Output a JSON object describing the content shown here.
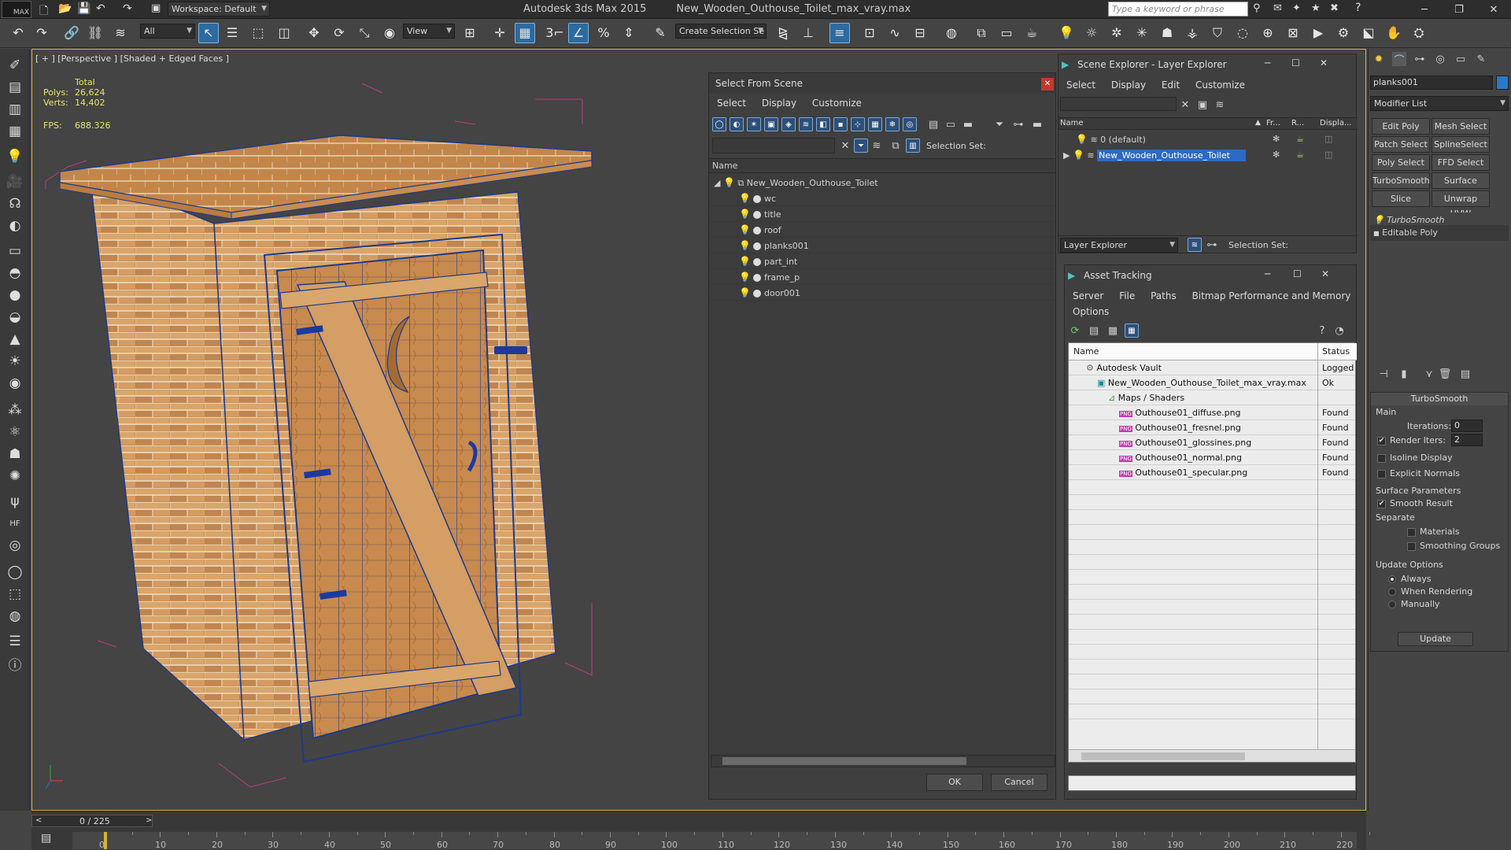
{
  "app": {
    "title": "Autodesk 3ds Max  2015",
    "file": "New_Wooden_Outhouse_Toilet_max_vray.max",
    "logo": "MAX"
  },
  "workspace": {
    "label": "Workspace: Default"
  },
  "search": {
    "placeholder": "Type a keyword or phrase"
  },
  "toolbar": {
    "filter": "All",
    "refcoord": "View",
    "selset": "Create Selection Se",
    "snap_label": "3"
  },
  "viewport": {
    "label": "[ + ] [Perspective ] [Shaded + Edged Faces ]",
    "stats": {
      "total": "Total",
      "polys_label": "Polys:",
      "polys": "26,624",
      "verts_label": "Verts:",
      "verts": "14,402",
      "fps_label": "FPS:",
      "fps": "688.326"
    }
  },
  "select_from_scene": {
    "title": "Select From Scene",
    "menu": [
      "Select",
      "Display",
      "Customize"
    ],
    "selset_label": "Selection Set:",
    "col_name": "Name",
    "root": "New_Wooden_Outhouse_Toilet",
    "children": [
      "wc",
      "title",
      "roof",
      "planks001",
      "part_int",
      "frame_p",
      "door001"
    ],
    "ok": "OK",
    "cancel": "Cancel"
  },
  "scene_explorer": {
    "title": "Scene Explorer - Layer Explorer",
    "menu": [
      "Select",
      "Display",
      "Edit",
      "Customize"
    ],
    "cols": [
      "Name",
      "Fr...",
      "R...",
      "Displa..."
    ],
    "layers": [
      "0 (default)",
      "New_Wooden_Outhouse_Toilet"
    ],
    "footer": "Layer Explorer",
    "selset_label": "Selection Set:"
  },
  "asset_tracking": {
    "title": "Asset Tracking",
    "menu": [
      "Server",
      "File",
      "Paths",
      "Bitmap Performance and Memory"
    ],
    "menu2": "Options",
    "cols": [
      "Name",
      "Status"
    ],
    "rows": [
      {
        "name": "Autodesk Vault",
        "status": "Logged",
        "indent": 0
      },
      {
        "name": "New_Wooden_Outhouse_Toilet_max_vray.max",
        "status": "Ok",
        "indent": 1
      },
      {
        "name": "Maps / Shaders",
        "status": "",
        "indent": 2
      },
      {
        "name": "Outhouse01_diffuse.png",
        "status": "Found",
        "indent": 3
      },
      {
        "name": "Outhouse01_fresnel.png",
        "status": "Found",
        "indent": 3
      },
      {
        "name": "Outhouse01_glossines.png",
        "status": "Found",
        "indent": 3
      },
      {
        "name": "Outhouse01_normal.png",
        "status": "Found",
        "indent": 3
      },
      {
        "name": "Outhouse01_specular.png",
        "status": "Found",
        "indent": 3
      }
    ],
    "png_badge": "PNG"
  },
  "command_panel": {
    "object_name": "planks001",
    "modifier_list": "Modifier List",
    "buttons": [
      "Edit Poly",
      "Mesh Select",
      "Patch Select",
      "SplineSelect",
      "Poly Select",
      "FFD Select",
      "TurboSmooth",
      "Surface Select",
      "Slice",
      "Unwrap UVW"
    ],
    "stack": [
      "TurboSmooth",
      "Editable Poly"
    ],
    "rollout": "TurboSmooth",
    "main": "Main",
    "iterations_label": "Iterations:",
    "iterations": "0",
    "render_iters_label": "Render Iters:",
    "render_iters": "2",
    "isoline": "Isoline Display",
    "explicit": "Explicit Normals",
    "surface_params": "Surface Parameters",
    "smooth_result": "Smooth Result",
    "separate": "Separate",
    "materials": "Materials",
    "smoothing_groups": "Smoothing Groups",
    "update_options": "Update Options",
    "always": "Always",
    "when_rendering": "When Rendering",
    "manually": "Manually",
    "update": "Update"
  },
  "timeline": {
    "frame": "0 / 225",
    "ticks": [
      "0",
      "10",
      "20",
      "30",
      "40",
      "50",
      "60",
      "70",
      "80",
      "90",
      "100",
      "110",
      "120",
      "130",
      "140",
      "150",
      "160",
      "170",
      "180",
      "190",
      "200",
      "210",
      "220"
    ]
  }
}
